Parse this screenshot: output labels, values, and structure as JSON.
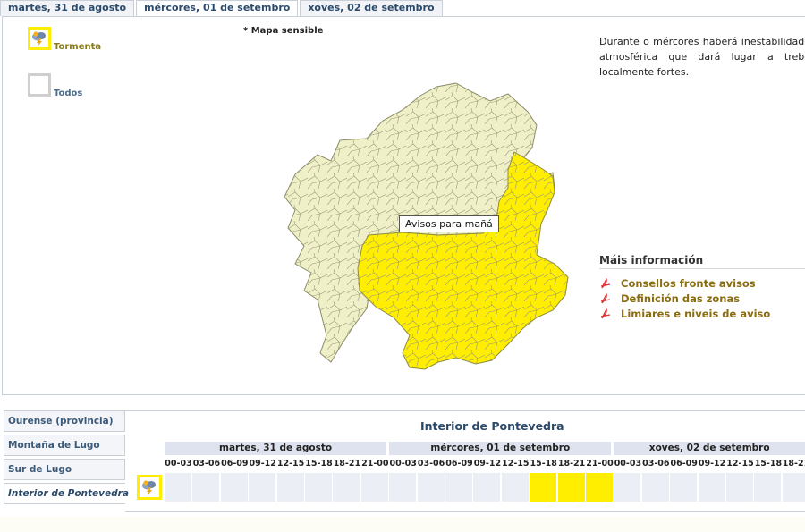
{
  "tabs": [
    {
      "label": "martes, 31 de agosto",
      "active": false
    },
    {
      "label": "mércores, 01 de setembro",
      "active": true
    },
    {
      "label": "xoves, 02 de setembro",
      "active": false
    }
  ],
  "legend": {
    "storm_label": "Tormenta",
    "all_label": "Todos",
    "storm_icon": "storm-cloud-icon"
  },
  "map": {
    "note": "* Mapa sensible",
    "tooltip": "Avisos para mañá",
    "base_color": "#f0f0c8",
    "warn_color": "#ffee00"
  },
  "description": "Durante o mércores haberá inestabilidade atmosférica que dará lugar a trebo localmente fortes.",
  "more_info": {
    "title": "Máis información",
    "links": [
      {
        "label": "Consellos fronte avisos",
        "icon": "pdf-icon"
      },
      {
        "label": "Definición das zonas",
        "icon": "pdf-icon"
      },
      {
        "label": "Limiares e niveis de aviso",
        "icon": "pdf-icon"
      }
    ]
  },
  "zones": [
    {
      "label": "Ourense (provincia)",
      "active": false
    },
    {
      "label": "Montaña de Lugo",
      "active": false
    },
    {
      "label": "Sur de Lugo",
      "active": false
    },
    {
      "label": "Interior de Pontevedra",
      "active": true
    }
  ],
  "zone_table": {
    "title": "Interior de Pontevedra",
    "days": [
      "martes, 31 de agosto",
      "mércores, 01 de setembro",
      "xoves, 02 de setembro"
    ],
    "hours": [
      "00-03",
      "03-06",
      "06-09",
      "09-12",
      "12-15",
      "15-18",
      "18-21",
      "21-00"
    ],
    "warnings": [
      [
        0,
        0,
        0,
        0,
        0,
        0,
        0,
        0
      ],
      [
        0,
        0,
        0,
        0,
        0,
        1,
        1,
        1
      ],
      [
        0,
        0,
        0,
        0,
        0,
        0,
        0,
        0
      ]
    ],
    "row_icon": "storm-cloud-icon"
  }
}
